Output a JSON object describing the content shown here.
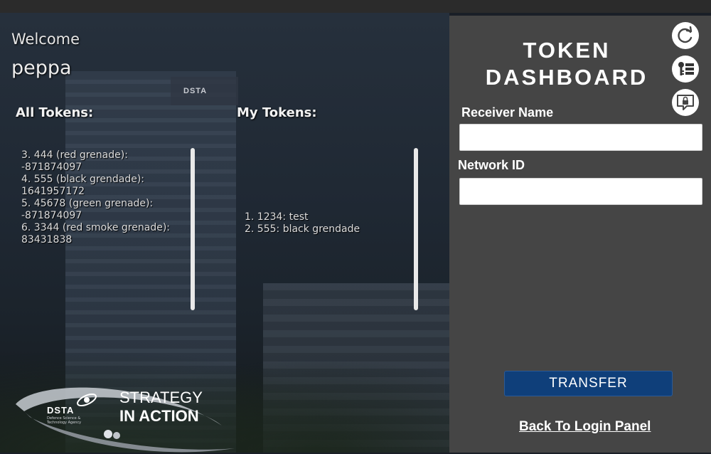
{
  "welcome_label": "Welcome",
  "username": "peppa",
  "all_tokens": {
    "title": "All Tokens:",
    "items": [
      "3. 444 (red grenade):  -871874097",
      "4. 555 (black grendade): 1641957172",
      "5. 45678 (green grenade):  -871874097",
      "6. 3344 (red smoke grenade): 83431838"
    ]
  },
  "my_tokens": {
    "title": "My Tokens:",
    "items": [
      "1. 1234: test",
      "2. 555: black grendade"
    ]
  },
  "brand": {
    "logo_text": "DSTA",
    "logo_subtext": "Defence Science & Technology Agency",
    "tagline_1": "STRATEGY",
    "tagline_2": "IN ACTION"
  },
  "panel": {
    "title_line1": "TOKEN",
    "title_line2": "DASHBOARD",
    "receiver_label": "Receiver Name",
    "receiver_value": "",
    "network_label": "Network ID",
    "network_value": "",
    "transfer_label": "TRANSFER",
    "back_label": "Back To Login Panel"
  },
  "icons": {
    "refresh": "refresh-icon",
    "token_list": "token-list-icon",
    "secure_chat": "secure-message-icon"
  },
  "colors": {
    "panel_bg": "#454545",
    "transfer_bg": "#0f3f7a"
  }
}
